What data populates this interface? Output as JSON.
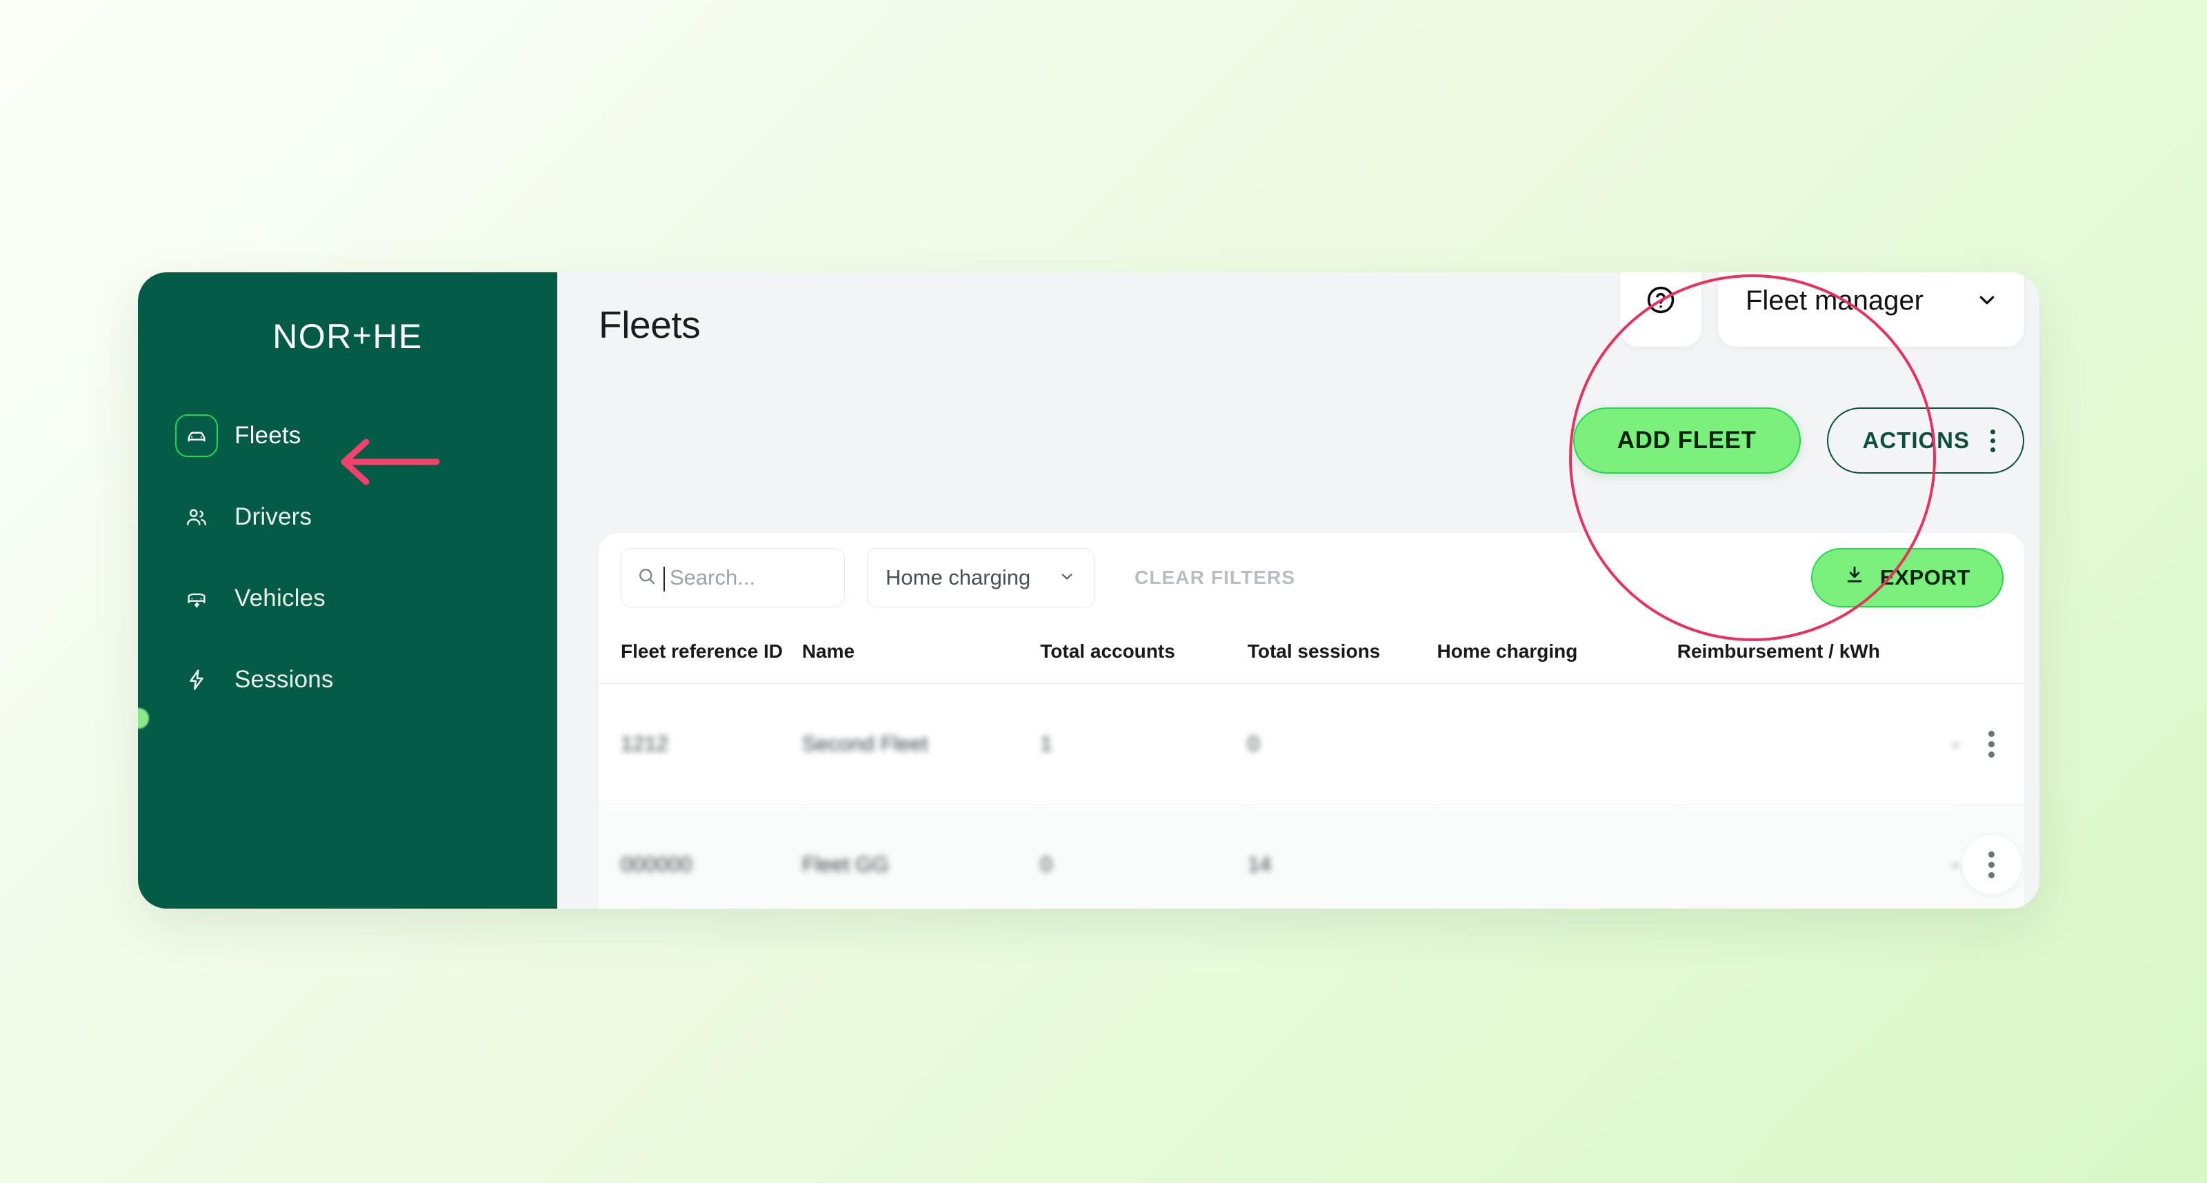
{
  "brand": {
    "name": "NOR+HE",
    "part_a": "NOR",
    "plus": "+",
    "part_b": "HE"
  },
  "sidebar": {
    "items": [
      {
        "label": "Fleets",
        "icon": "car-front-icon",
        "active": true
      },
      {
        "label": "Drivers",
        "icon": "people-icon",
        "active": false
      },
      {
        "label": "Vehicles",
        "icon": "vehicle-bolt-icon",
        "active": false
      },
      {
        "label": "Sessions",
        "icon": "lightning-bolt-icon",
        "active": false
      }
    ]
  },
  "header": {
    "title": "Fleets",
    "help_icon": "question-circle-icon",
    "role_select": {
      "value": "Fleet manager",
      "chevron": "chevron-down-icon"
    },
    "add_fleet_label": "ADD FLEET",
    "actions_label": "ACTIONS",
    "actions_menu_icon": "dots-vertical-icon"
  },
  "filters": {
    "search": {
      "placeholder": "Search...",
      "value": "",
      "icon": "search-icon"
    },
    "home_charging": {
      "label": "Home charging",
      "chevron": "chevron-down-icon"
    },
    "clear_filters_label": "CLEAR FILTERS",
    "export": {
      "label": "EXPORT",
      "icon": "download-icon"
    }
  },
  "table": {
    "columns": [
      "Fleet reference ID",
      "Name",
      "Total accounts",
      "Total sessions",
      "Home charging",
      "Reimbursement / kWh"
    ],
    "rows": [
      {
        "fleet_reference_id": "1212",
        "name": "Second Fleet",
        "total_accounts": "1",
        "total_sessions": "0",
        "home_charging": "",
        "reimbursement_per_kwh": "-",
        "row_menu_icon": "dots-vertical-icon"
      },
      {
        "fleet_reference_id": "000000",
        "name": "Fleet GG",
        "total_accounts": "0",
        "total_sessions": "14",
        "home_charging": "",
        "reimbursement_per_kwh": "-",
        "row_menu_icon": "dots-vertical-icon"
      }
    ]
  },
  "annotations": {
    "circle": {
      "target": "add-fleet-button",
      "color": "#e8315c"
    },
    "arrow": {
      "target": "sidebar-item-fleets",
      "direction": "left",
      "color": "#f2426b"
    }
  },
  "colors": {
    "sidebar_green": "#045c47",
    "accent_green": "#23d84f",
    "button_green": "#7cf07c",
    "annotation_red": "#e8315c",
    "page_bg_start": "#fbfff8",
    "page_bg_end": "#d9f7c7"
  }
}
